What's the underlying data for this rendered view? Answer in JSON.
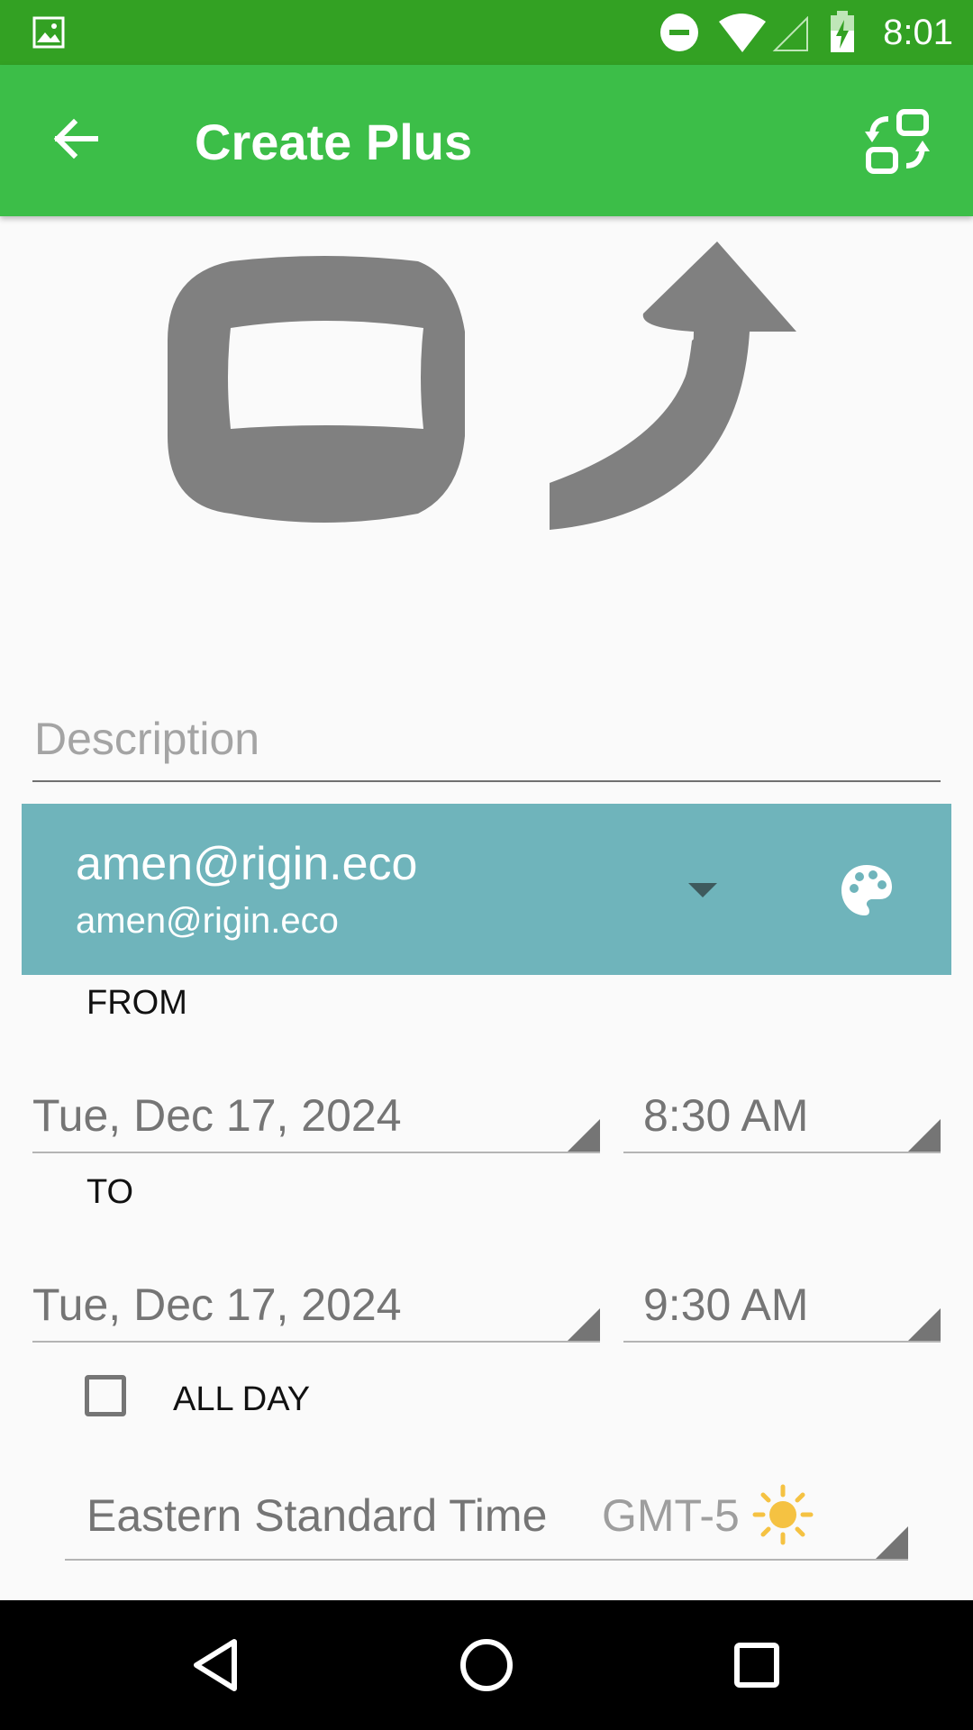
{
  "status_bar": {
    "time": "8:01",
    "icons": [
      "image-icon",
      "do-not-disturb-icon",
      "wifi-icon",
      "signal-icon",
      "battery-charging-icon"
    ]
  },
  "app_bar": {
    "title": "Create Plus",
    "back_icon": "arrow-back-icon",
    "action_icon": "switch-layout-icon"
  },
  "hero": {
    "icon": "rounded-square-with-curved-arrow-icon",
    "color": "#808080"
  },
  "form": {
    "description": {
      "placeholder": "Description",
      "value": ""
    },
    "account": {
      "name": "amen@rigin.eco",
      "email": "amen@rigin.eco",
      "color": "#6fb4bb"
    },
    "from": {
      "label": "FROM",
      "date": "Tue, Dec 17, 2024",
      "time": "8:30 AM"
    },
    "to": {
      "label": "TO",
      "date": "Tue, Dec 17, 2024",
      "time": "9:30 AM"
    },
    "all_day": {
      "label": "ALL DAY",
      "checked": false
    },
    "timezone": {
      "name": "Eastern Standard Time",
      "offset": "GMT-5",
      "icon": "sun-icon"
    }
  },
  "nav_bar": {
    "icons": [
      "back-triangle-icon",
      "home-circle-icon",
      "recents-square-icon"
    ]
  },
  "colors": {
    "status_bar": "#33a123",
    "app_bar": "#3cbe48",
    "account_bg": "#6fb4bb",
    "sun": "#f5c242"
  }
}
